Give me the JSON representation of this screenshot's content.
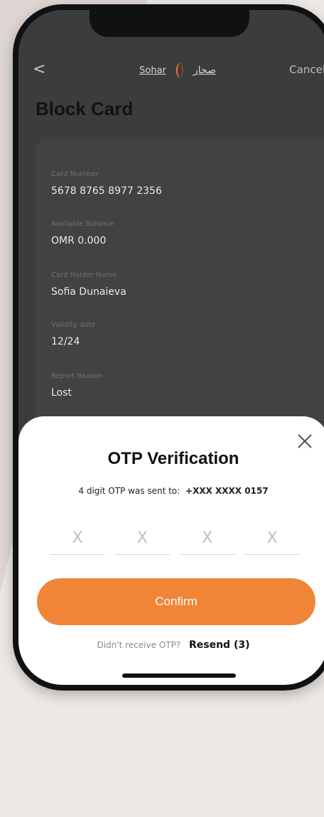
{
  "nav": {
    "back_symbol": "<",
    "brand_en": "Sohar",
    "brand_ar": "صحار",
    "cancel_label": "Cancel"
  },
  "page": {
    "title": "Block Card"
  },
  "card_details": {
    "fields": [
      {
        "label": "Card Number",
        "value": "5678 8765 8977 2356"
      },
      {
        "label": "Available Balance",
        "value": "OMR 0.000"
      },
      {
        "label": "Card Holder Name",
        "value": "Sofia Dunaieva"
      },
      {
        "label": "Validity date",
        "value": "12/24"
      },
      {
        "label": "Report Reason",
        "value": "Lost"
      }
    ]
  },
  "otp_sheet": {
    "title": "OTP Verification",
    "sent_text": "4 digit OTP was sent to:",
    "phone_number": "+XXX XXXX 0157",
    "digit_placeholder": "X",
    "confirm_label": "Confirm",
    "resend_prompt": "Didn't receive OTP?",
    "resend_label": "Resend (3)"
  },
  "colors": {
    "accent": "#f08538",
    "overlay_bg": "#3b3c3d",
    "sheet_bg": "#ffffff"
  },
  "icons": {
    "close": "close-icon",
    "back": "chevron-left-icon",
    "logo": "sohar-logo"
  }
}
